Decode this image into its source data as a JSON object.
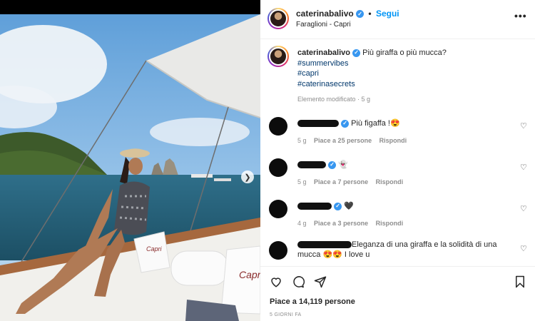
{
  "post": {
    "username": "caterinabalivo",
    "follow_label": "Segui",
    "location": "Faraglioni - Capri",
    "more_icon": "more-horizontal-icon",
    "photo": {
      "pillow_text_1": "Capri",
      "pillow_text_2": "Capri"
    }
  },
  "caption": {
    "username": "caterinabalivo",
    "text": "Più giraffa o più mucca?",
    "hashtags": [
      "#summervibes",
      "#capri",
      "#caterinasecrets"
    ],
    "meta": "Elemento modificato · 5 g"
  },
  "comments": [
    {
      "text": "Più figaffa !😍",
      "time": "5 g",
      "likes": "Piace a 25 persone",
      "reply": "Rispondi"
    },
    {
      "text": "👻",
      "time": "5 g",
      "likes": "Piace a 7 persone",
      "reply": "Rispondi"
    },
    {
      "text": "🖤",
      "time": "4 g",
      "likes": "Piace a 3 persone",
      "reply": "Rispondi"
    },
    {
      "text": "Eleganza di una giraffa e la solidità di una mucca 😍😍 I love u",
      "time": "",
      "likes": "",
      "reply": ""
    }
  ],
  "actions": {
    "likes": "Piace a 14,119 persone",
    "posted": "5 GIORNI FA"
  },
  "colors": {
    "link": "#0095f6",
    "hashtag": "#00376b",
    "meta": "#8e8e8e"
  }
}
